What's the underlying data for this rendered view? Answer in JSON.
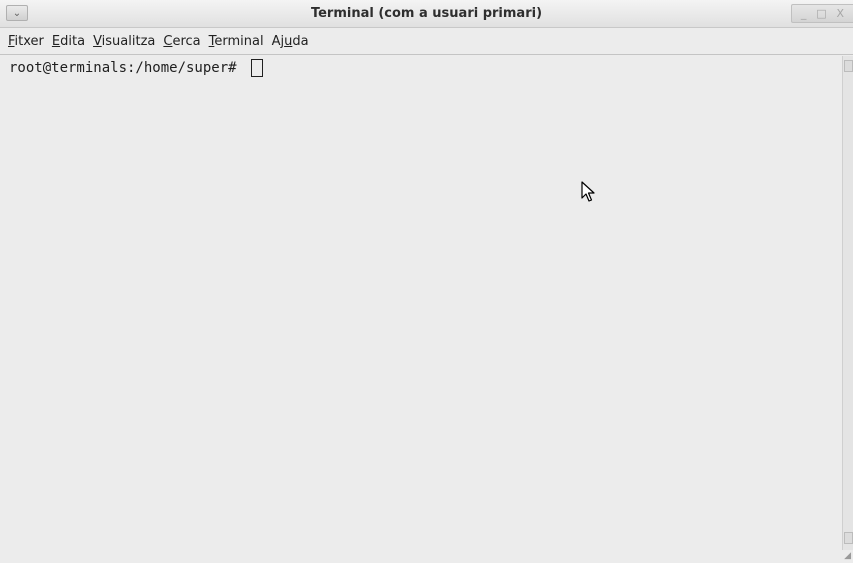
{
  "window": {
    "title": "Terminal (com a usuari primari)",
    "menu_button_glyph": "⌄",
    "controls": [
      "_",
      "□",
      "X"
    ]
  },
  "menubar": {
    "items": [
      {
        "mnemonic": "F",
        "rest": "itxer"
      },
      {
        "mnemonic": "E",
        "rest": "dita"
      },
      {
        "mnemonic": "V",
        "rest": "isualitza"
      },
      {
        "mnemonic": "C",
        "rest": "erca"
      },
      {
        "mnemonic": "T",
        "rest": "erminal"
      },
      {
        "pre": "Aj",
        "mnemonic": "u",
        "rest": "da"
      }
    ]
  },
  "terminal": {
    "prompt": "root@terminals:/home/super# "
  },
  "icons": {
    "window_menu": "chevron-down-icon",
    "pointer": "mouse-pointer-icon",
    "resize": "resize-grip-icon"
  },
  "colors": {
    "background": "#ececec",
    "text": "#1f1f1f"
  }
}
